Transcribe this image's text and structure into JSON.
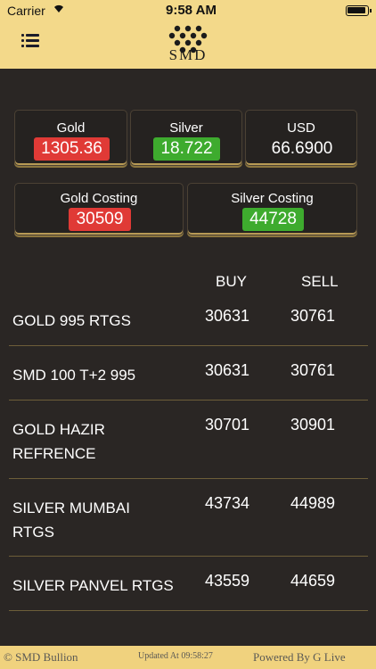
{
  "status_bar": {
    "carrier": "Carrier",
    "time": "9:58 AM"
  },
  "header": {
    "menu_icon": "list-menu-icon",
    "logo_text": "SMD"
  },
  "rates": [
    {
      "label": "Gold",
      "value": "1305.36",
      "color": "#e03a36"
    },
    {
      "label": "Silver",
      "value": "18.722",
      "color": "#3eab2e"
    },
    {
      "label": "USD",
      "value": "66.6900"
    }
  ],
  "costing": [
    {
      "label": "Gold Costing",
      "value": "30509",
      "color": "#e03a36"
    },
    {
      "label": "Silver Costing",
      "value": "44728",
      "color": "#3eab2e"
    }
  ],
  "table": {
    "buy_header": "BUY",
    "sell_header": "SELL",
    "rows": [
      {
        "name": "GOLD 995 RTGS",
        "buy": "30631",
        "sell": "30761"
      },
      {
        "name": "SMD 100 T+2 995",
        "buy": "30631",
        "sell": "30761"
      },
      {
        "name": "GOLD HAZIR REFRENCE",
        "buy": "30701",
        "sell": "30901"
      },
      {
        "name": "SILVER MUMBAI RTGS",
        "buy": "43734",
        "sell": "44989"
      },
      {
        "name": "SILVER PANVEL RTGS",
        "buy": "43559",
        "sell": "44659"
      }
    ]
  },
  "footer": {
    "left": "© SMD Bullion",
    "middle": "Updated At 09:58:27",
    "right": "Powered By G Live"
  },
  "colors": {
    "accent": "#f3d98a",
    "background": "#2a2624",
    "down": "#e03a36",
    "up": "#3eab2e"
  }
}
